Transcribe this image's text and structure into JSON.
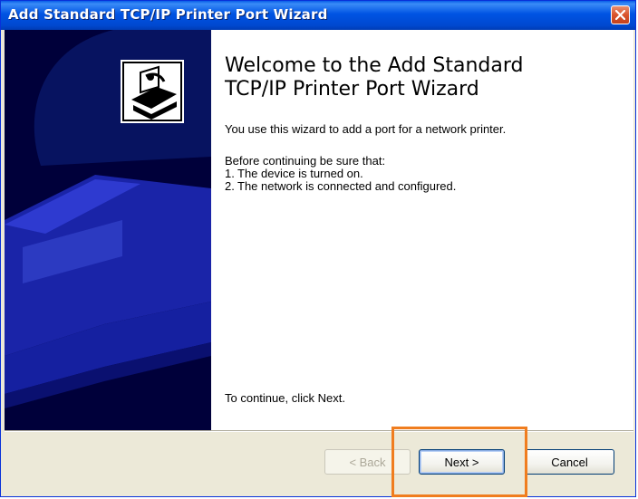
{
  "window": {
    "title": "Add Standard TCP/IP Printer Port Wizard"
  },
  "content": {
    "heading_line1": "Welcome to the Add Standard",
    "heading_line2": "TCP/IP Printer Port Wizard",
    "intro": "You use this wizard to add a port for a network printer.",
    "before": "Before continuing be sure that:",
    "conditions": [
      {
        "num": "1.",
        "text": "The device is turned on."
      },
      {
        "num": "2.",
        "text": "The network is connected and configured."
      }
    ],
    "continue": "To continue, click Next."
  },
  "buttons": {
    "back": "< Back",
    "next": "Next >",
    "cancel": "Cancel"
  },
  "colors": {
    "titlebar": "#0054e3",
    "banner": "#00003a",
    "highlight": "#f07d1f"
  }
}
